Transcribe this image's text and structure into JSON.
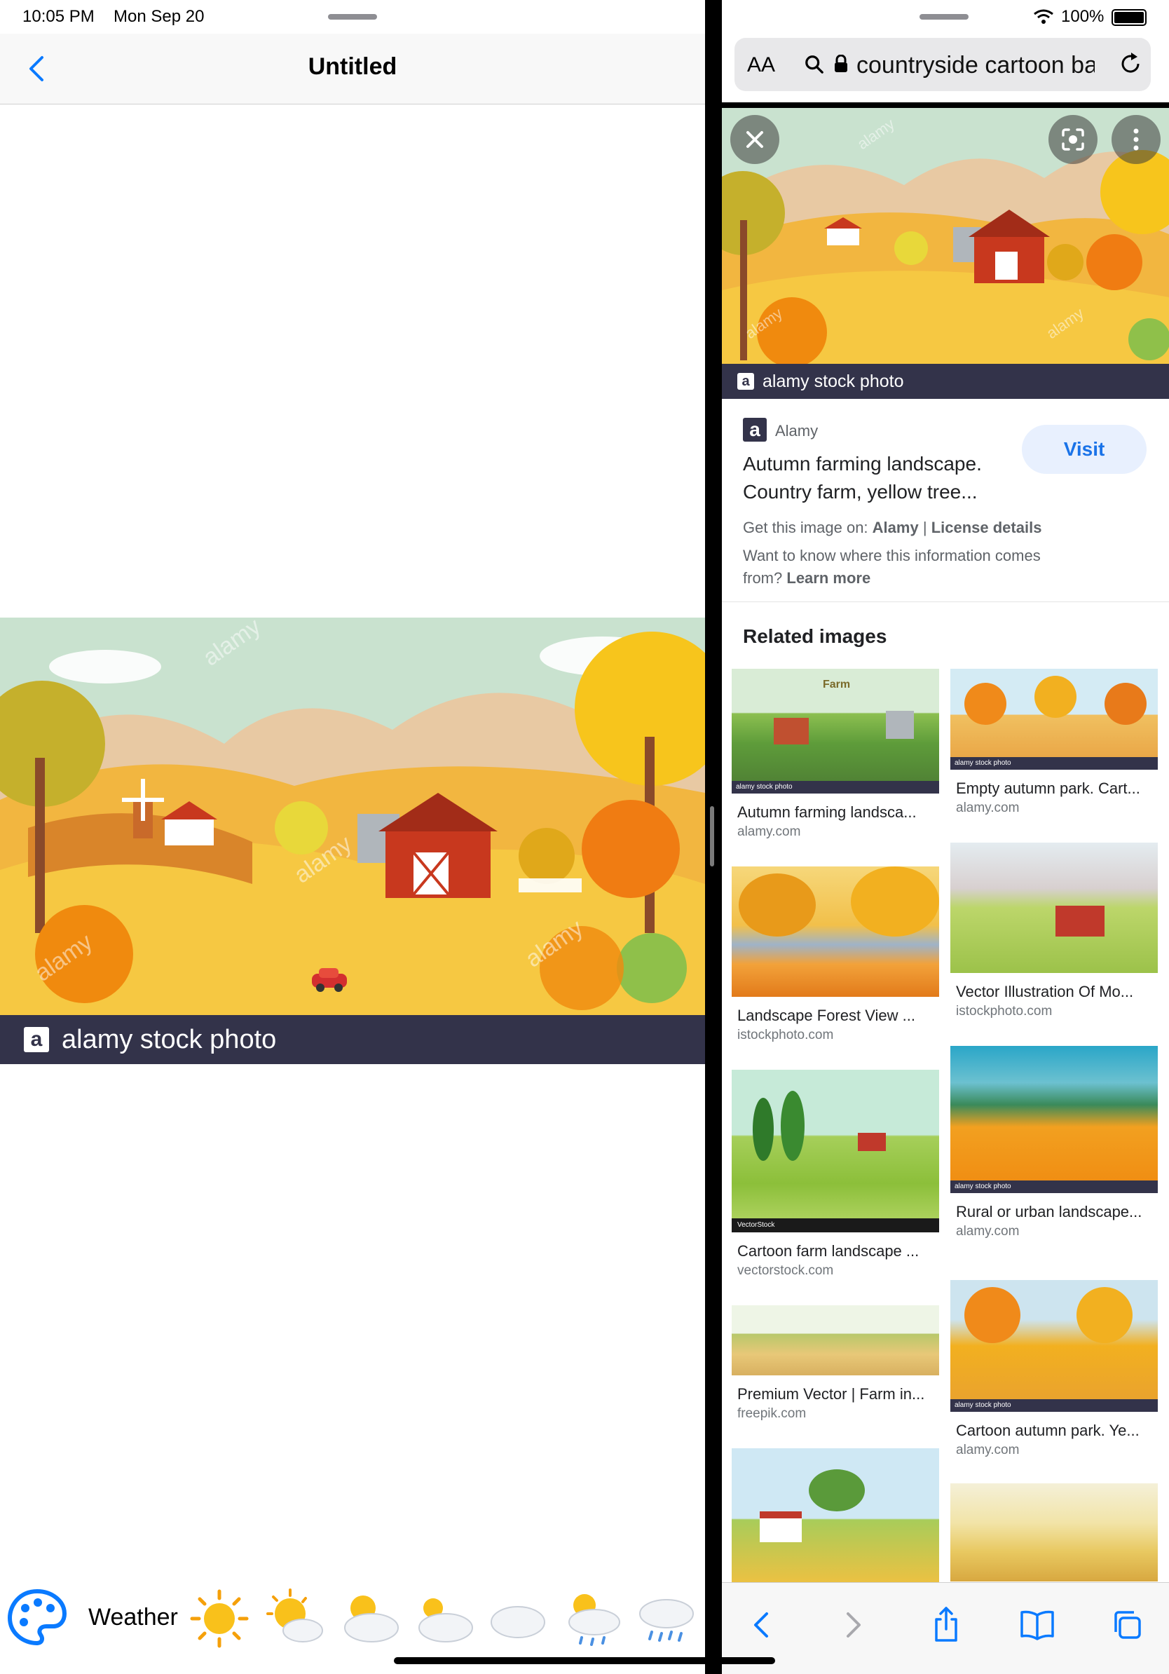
{
  "status_left": {
    "time": "10:05 PM",
    "date": "Mon Sep 20"
  },
  "status_right": {
    "battery": "100%"
  },
  "left_nav": {
    "title": "Untitled"
  },
  "left_image": {
    "watermark": "alamy stock photo",
    "logo_letter": "a",
    "overlay_text": "alamy"
  },
  "left_toolbar": {
    "label": "Weather",
    "icons": [
      "sun-icon",
      "sun-behind-small-cloud-icon",
      "sun-behind-cloud-icon",
      "sun-behind-large-cloud-icon",
      "cloud-icon",
      "sun-behind-rain-cloud-icon",
      "cloud-with-rain-icon"
    ]
  },
  "browser": {
    "aa_label": "AA",
    "url_text": "countryside cartoon ba",
    "hero_caption": "alamy stock photo",
    "source_name": "Alamy",
    "title_line1": "Autumn farming landscape.",
    "title_line2": "Country farm, yellow tree...",
    "visit_label": "Visit",
    "get_image_prefix": "Get this image on:",
    "get_image_source": "Alamy",
    "license": "License details",
    "know_where": "Want to know where this information comes",
    "know_where2": "from?",
    "learn_more": "Learn more",
    "related_title": "Related images",
    "related": [
      {
        "title": "Autumn farming landsca...",
        "source": "alamy.com"
      },
      {
        "title": "Empty autumn park. Cart...",
        "source": "alamy.com"
      },
      {
        "title": "Landscape Forest View ...",
        "source": "istockphoto.com"
      },
      {
        "title": "Vector Illustration Of Mo...",
        "source": "istockphoto.com"
      },
      {
        "title": "Cartoon farm landscape ...",
        "source": "vectorstock.com"
      },
      {
        "title": "Rural or urban landscape...",
        "source": "alamy.com"
      },
      {
        "title": "Premium Vector | Farm in...",
        "source": "freepik.com"
      },
      {
        "title": "Cartoon autumn park. Ye...",
        "source": "alamy.com"
      }
    ],
    "thumb_watermark": "alamy stock photo",
    "vectorstock_mark": "VectorStock",
    "farm_sign": "Farm"
  },
  "colors": {
    "accent": "#1a73e8",
    "ios_blue": "#0a7aff",
    "caption_bg": "#33334a"
  }
}
